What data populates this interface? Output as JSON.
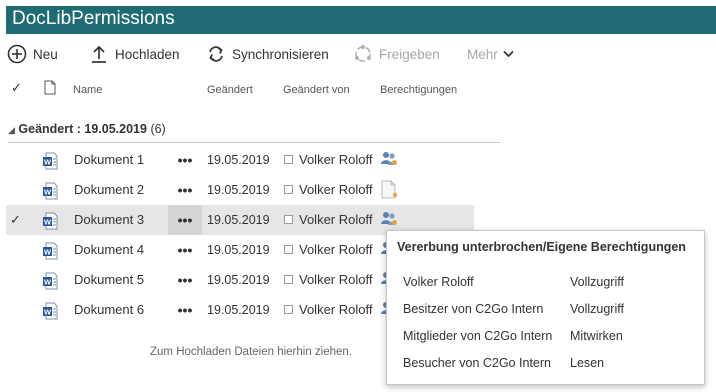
{
  "title": "DocLibPermissions",
  "commands": {
    "new": "Neu",
    "upload": "Hochladen",
    "sync": "Synchronisieren",
    "share": "Freigeben",
    "more": "Mehr"
  },
  "columns": {
    "name": "Name",
    "modified": "Geändert",
    "modified_by": "Geändert von",
    "permissions": "Berechtigungen"
  },
  "group": {
    "label": "Geändert : 19.05.2019",
    "count": "(6)"
  },
  "rows": [
    {
      "name": "Dokument 1",
      "more": "•••",
      "date": "19.05.2019",
      "by": "Volker Roloff",
      "perm_icon": "users-permission-icon",
      "selected": false
    },
    {
      "name": "Dokument 2",
      "more": "•••",
      "date": "19.05.2019",
      "by": "Volker Roloff",
      "perm_icon": "document-permission-icon",
      "selected": false
    },
    {
      "name": "Dokument 3",
      "more": "•••",
      "date": "19.05.2019",
      "by": "Volker Roloff",
      "perm_icon": "users-permission-icon",
      "selected": true
    },
    {
      "name": "Dokument 4",
      "more": "•••",
      "date": "19.05.2019",
      "by": "Volker Roloff",
      "perm_icon": "users-permission-icon",
      "selected": false
    },
    {
      "name": "Dokument 5",
      "more": "•••",
      "date": "19.05.2019",
      "by": "Volker Roloff",
      "perm_icon": "users-permission-icon",
      "selected": false
    },
    {
      "name": "Dokument 6",
      "more": "•••",
      "date": "19.05.2019",
      "by": "Volker Roloff",
      "perm_icon": "users-permission-icon",
      "selected": false
    }
  ],
  "drop_hint": "Zum Hochladen Dateien hierhin ziehen.",
  "callout": {
    "title": "Vererbung unterbrochen/Eigene Berechtigungen",
    "entries": [
      {
        "principal": "Volker Roloff",
        "level": "Vollzugriff"
      },
      {
        "principal": "Besitzer von C2Go Intern",
        "level": "Vollzugriff"
      },
      {
        "principal": "Mitglieder von C2Go Intern",
        "level": "Mitwirken"
      },
      {
        "principal": "Besucher von C2Go Intern",
        "level": "Lesen"
      }
    ]
  },
  "colors": {
    "titlebar": "#1f6b73",
    "selected_row": "#e6e6e6",
    "word_icon": "#2b579a",
    "people_icon": "#5b7fb6",
    "people_accent": "#e8a33c"
  }
}
